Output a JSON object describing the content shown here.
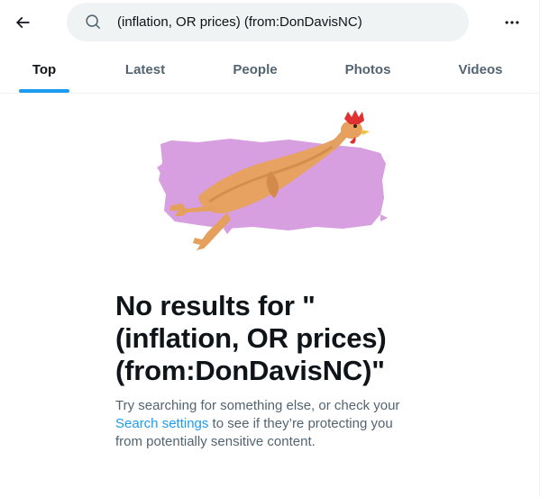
{
  "header": {
    "back_icon": "arrow-left-icon",
    "search_icon": "search-icon",
    "search_value": "(inflation, OR prices) (from:DonDavisNC)",
    "more_icon": "more-horizontal-icon"
  },
  "tabs": [
    {
      "label": "Top",
      "active": true
    },
    {
      "label": "Latest",
      "active": false
    },
    {
      "label": "People",
      "active": false
    },
    {
      "label": "Photos",
      "active": false
    },
    {
      "label": "Videos",
      "active": false
    }
  ],
  "illustration": {
    "icon": "rubber-chicken-illustration",
    "background_color": "#d79fdf"
  },
  "empty_state": {
    "title": "No results for \"\n(inflation, OR prices)\n(from:DonDavisNC)\"",
    "body_before_link": "Try searching for something else, or check your ",
    "link_text": "Search settings",
    "body_after_link": " to see if they’re protecting you from potentially sensitive content."
  },
  "colors": {
    "accent": "#1d9bf0",
    "text_primary": "#0f1419",
    "text_secondary": "#536471",
    "search_bg": "#eff3f4"
  }
}
